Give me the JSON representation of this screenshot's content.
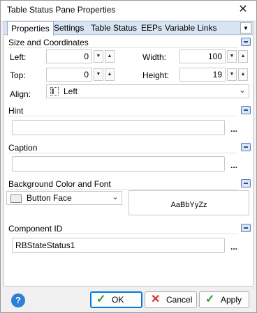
{
  "window": {
    "title": "Table Status Pane Properties",
    "close_glyph": "✕"
  },
  "tabs": {
    "items": [
      "Properties",
      "Settings",
      "Table Status",
      "EEPs",
      "Variable Links"
    ],
    "active": "Properties",
    "dropdown_glyph": "▼"
  },
  "size_coords": {
    "title": "Size and Coordinates",
    "left_label": "Left:",
    "left_value": "0",
    "top_label": "Top:",
    "top_value": "0",
    "width_label": "Width:",
    "width_value": "100",
    "height_label": "Height:",
    "height_value": "19",
    "align_label": "Align:",
    "align_value": "Left",
    "spin_down": "▼",
    "spin_up": "▲"
  },
  "hint": {
    "title": "Hint",
    "value": "",
    "ellipsis": "..."
  },
  "caption": {
    "title": "Caption",
    "value": "",
    "ellipsis": "..."
  },
  "background": {
    "title": "Background Color and Font",
    "color_value": "Button Face",
    "font_preview": "AaBbYyZz"
  },
  "component_id": {
    "title": "Component ID",
    "value": "RBStateStatus1",
    "ellipsis": "..."
  },
  "footer": {
    "help_glyph": "?",
    "ok_label": "OK",
    "cancel_label": "Cancel",
    "apply_label": "Apply"
  },
  "colors": {
    "help_blue": "#2f7fd8",
    "ok_green": "#2e9b2e",
    "cancel_red": "#d62d2d",
    "accent": "#0078d7"
  }
}
